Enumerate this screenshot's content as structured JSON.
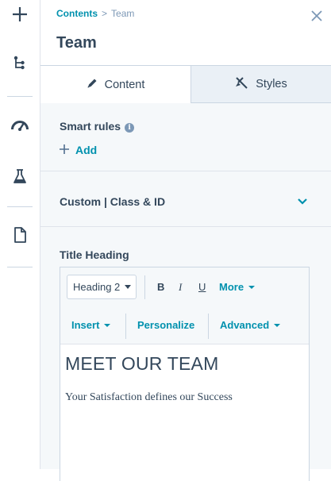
{
  "rail": {
    "items": [
      {
        "icon": "plus-icon"
      },
      {
        "icon": "tree-structure-icon"
      },
      {
        "icon": "speedometer-icon"
      },
      {
        "icon": "flask-icon"
      },
      {
        "icon": "document-icon"
      }
    ]
  },
  "header": {
    "breadcrumb_parent": "Contents",
    "breadcrumb_sep": ">",
    "breadcrumb_current": "Team",
    "title": "Team"
  },
  "tabs": {
    "content_label": "Content",
    "styles_label": "Styles"
  },
  "smart_rules": {
    "label": "Smart rules",
    "info_glyph": "i",
    "add_label": "Add"
  },
  "custom_section": {
    "label": "Custom | Class & ID"
  },
  "title_heading": {
    "label": "Title Heading",
    "toolbar": {
      "block_style": "Heading 2",
      "bold": "B",
      "italic": "I",
      "underline": "U",
      "more": "More",
      "insert": "Insert",
      "personalize": "Personalize",
      "advanced": "Advanced"
    },
    "heading_text": "MEET OUR TEAM",
    "body_text": "Your Satisfaction defines our Success"
  },
  "colors": {
    "accent": "#0091ae",
    "text": "#33475b",
    "panel_bg": "#f5f8fa",
    "tab_inactive_bg": "#eaf0f6"
  }
}
